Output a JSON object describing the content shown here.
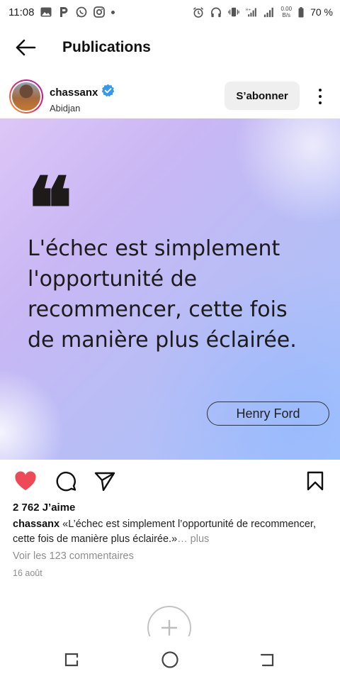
{
  "status_bar": {
    "time": "11:08",
    "left_icons": [
      "gallery-icon",
      "p-app-icon",
      "whatsapp-icon",
      "instagram-icon",
      "notification-dot-icon"
    ],
    "right_icons": [
      "alarm-icon",
      "headset-icon",
      "vibrate-icon",
      "signal-h-plus-icon",
      "signal-icon"
    ],
    "network_speed_value": "0.00",
    "network_speed_unit": "B/s",
    "battery": "70 %"
  },
  "header": {
    "title": "Publications"
  },
  "post": {
    "username": "chassanx",
    "verified": true,
    "location": "Abidjan",
    "follow_label": "S’abonner",
    "image": {
      "quote_mark": "❝",
      "quote_lines": [
        "L'échec est simplement",
        "l'opportunité de",
        "recommencer, cette fois",
        "de manière plus éclairée."
      ],
      "author": "Henry Ford"
    },
    "liked": true,
    "likes": "2 762 J’aime",
    "caption_user": "chassanx",
    "caption_text": " «L’échec est simplement l’opportunité de recommencer, cette fois de manière plus éclairée.»",
    "caption_more": "… plus",
    "comments_link": "Voir les 123 commentaires",
    "date": "16 août"
  },
  "colors": {
    "like_red": "#ed4956",
    "verified_blue": "#3897f0",
    "muted_text": "#8e8e8e"
  }
}
